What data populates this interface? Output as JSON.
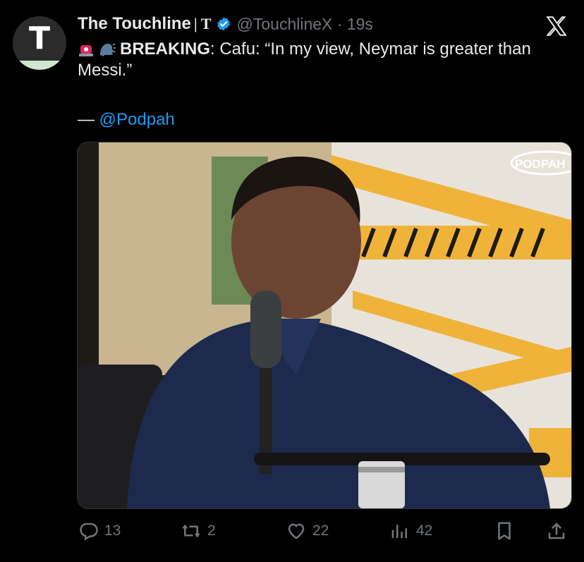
{
  "tweet": {
    "display_name": "The Touchline",
    "name_mark": "| T",
    "handle": "@TouchlineX · 19s",
    "breaking_label": "BREAKING",
    "body": ": Cafu: “In my view, Neymar is greater than Messi.”",
    "credit_prefix": "— ",
    "credit_mention": "@Podpah",
    "avatar_letter": "T",
    "media_watermark": "PODPAH"
  },
  "actions": {
    "replies": "13",
    "reposts": "2",
    "likes": "22",
    "views": "42"
  },
  "colors": {
    "accent": "#1d9bf0",
    "muted": "#71767b",
    "tape": "#f0b33a"
  },
  "icons": [
    "x-logo-icon",
    "verified-icon",
    "siren-emoji-icon",
    "speaking-head-emoji-icon",
    "reply-icon",
    "repost-icon",
    "like-icon",
    "views-icon",
    "bookmark-icon",
    "share-icon"
  ]
}
